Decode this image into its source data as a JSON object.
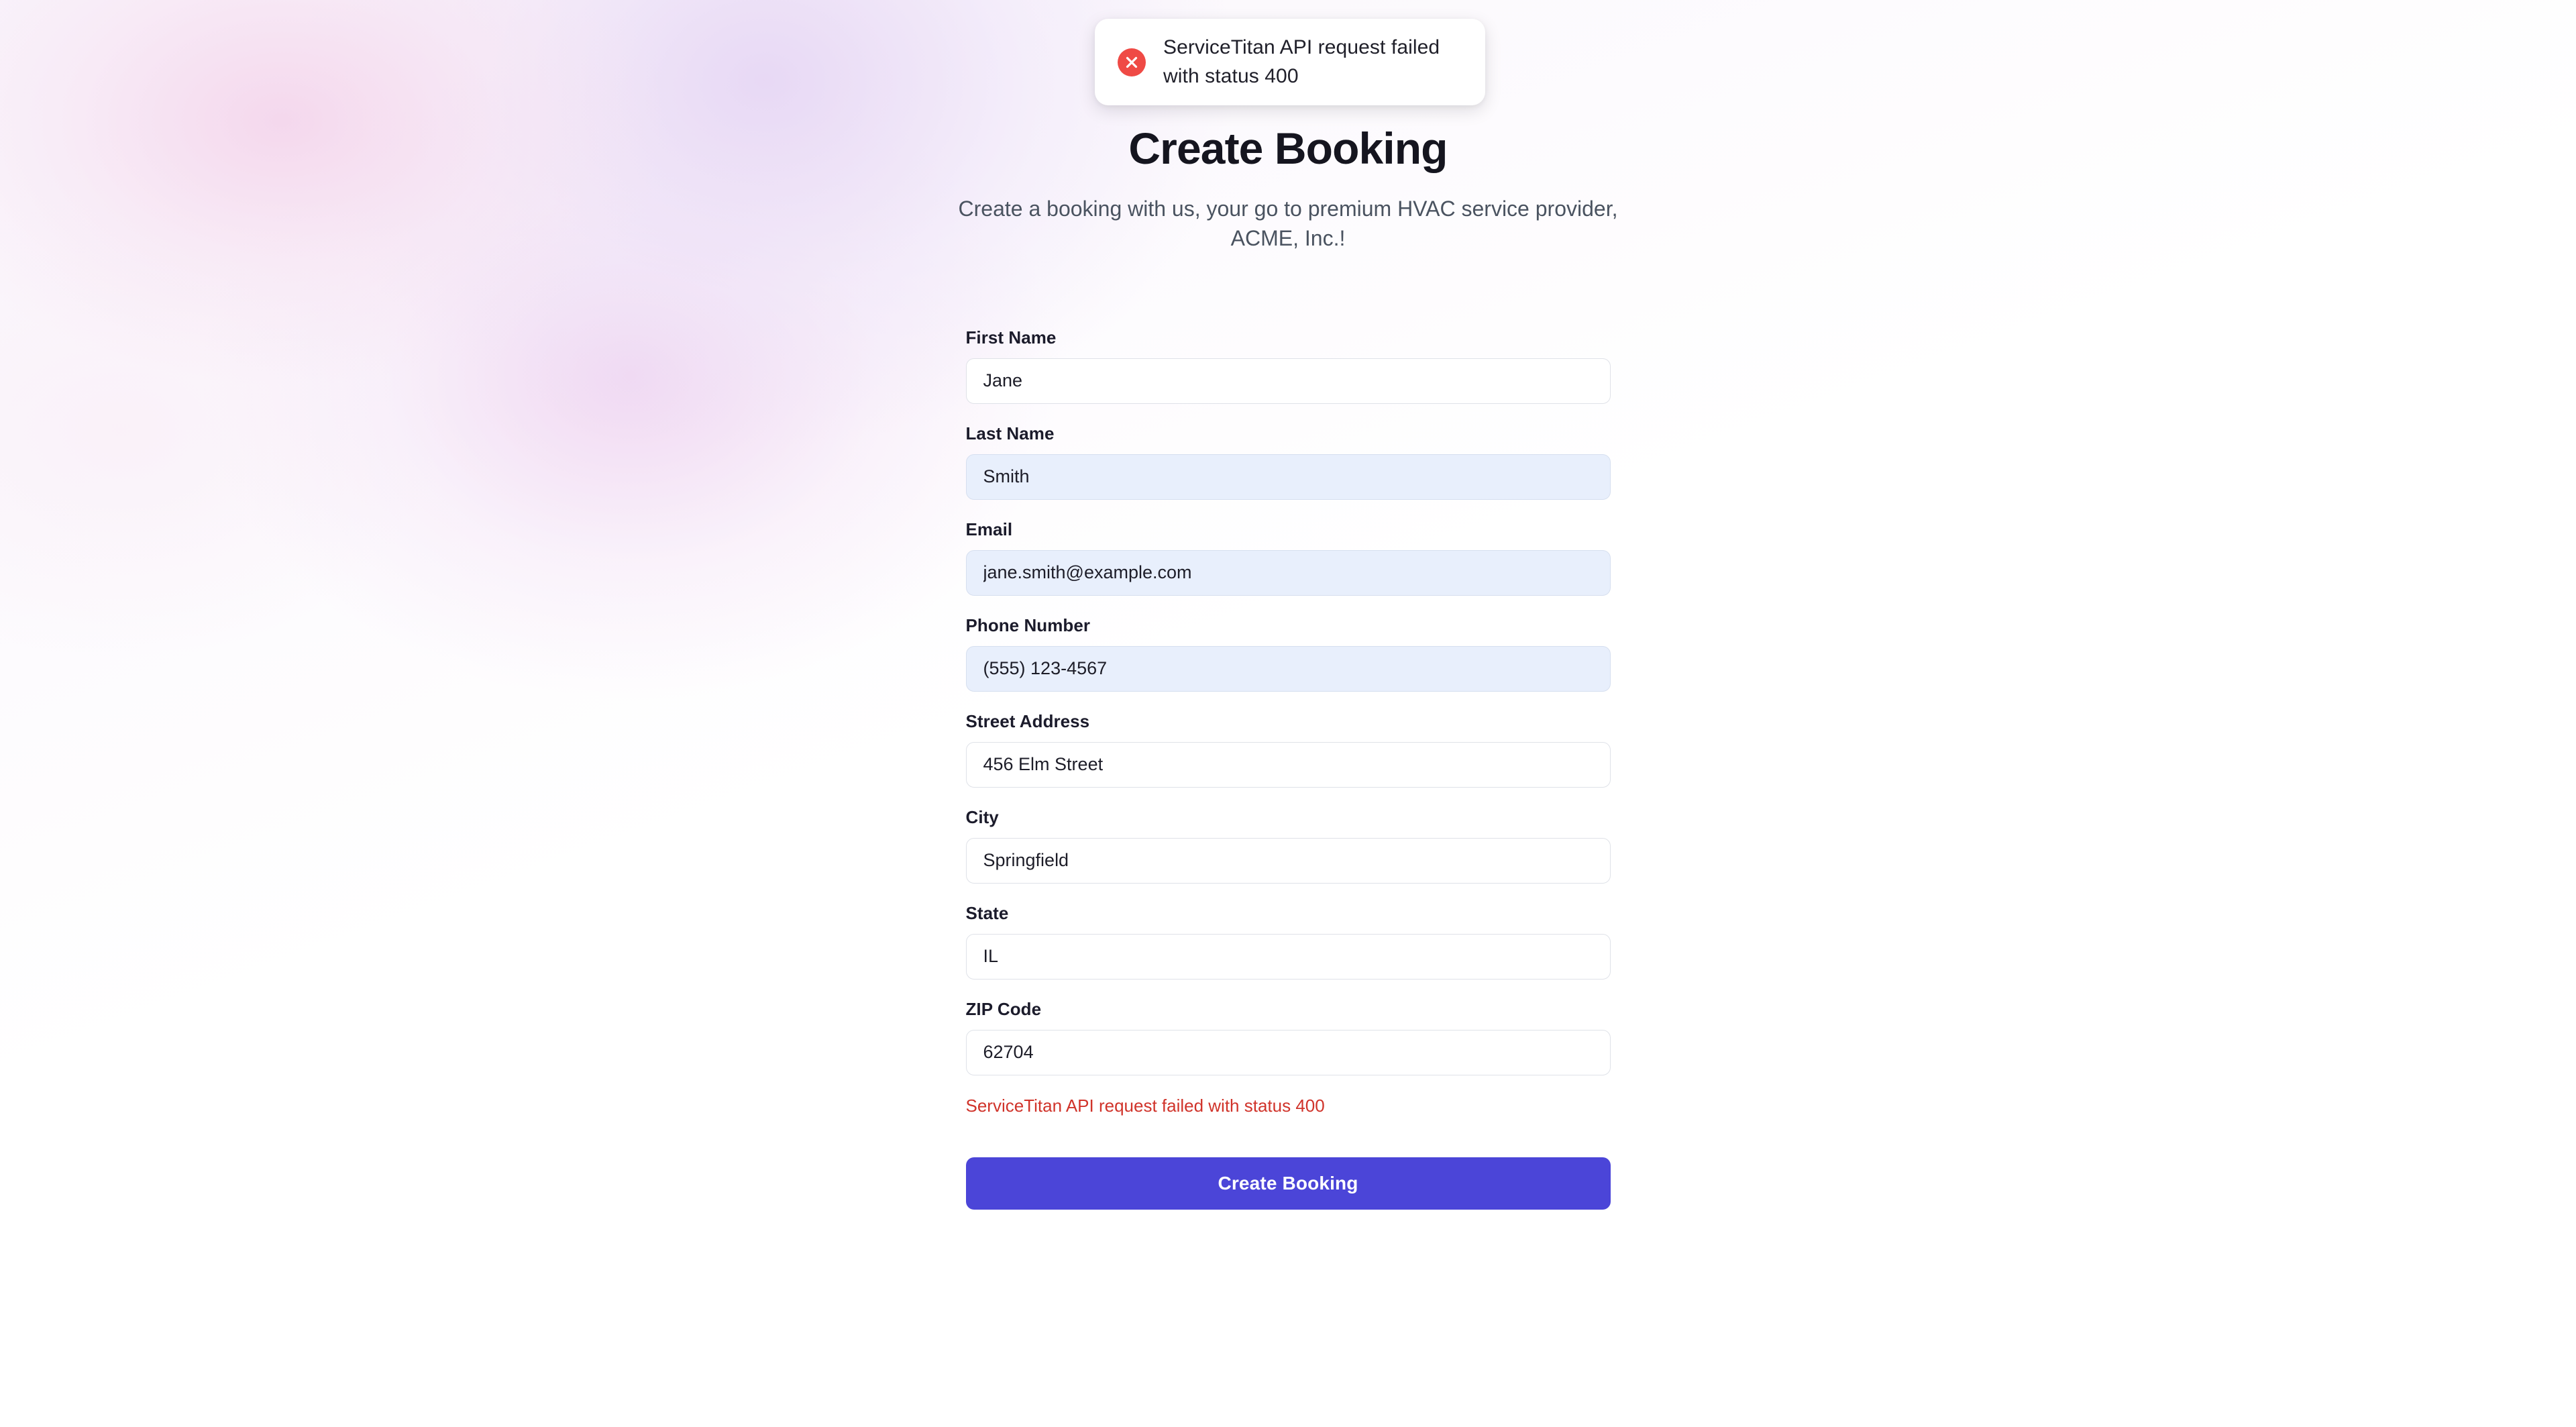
{
  "toast": {
    "icon": "error-circle-x-icon",
    "message": "ServiceTitan API request failed with status 400"
  },
  "header": {
    "title": "Create Booking",
    "subtitle": "Create a booking with us, your go to premium HVAC service provider, ACME, Inc.!"
  },
  "form": {
    "fields": [
      {
        "label": "First Name",
        "value": "Jane",
        "autofilled": false
      },
      {
        "label": "Last Name",
        "value": "Smith",
        "autofilled": true
      },
      {
        "label": "Email",
        "value": "jane.smith@example.com",
        "autofilled": true
      },
      {
        "label": "Phone Number",
        "value": "(555) 123-4567",
        "autofilled": true
      },
      {
        "label": "Street Address",
        "value": "456 Elm Street",
        "autofilled": false
      },
      {
        "label": "City",
        "value": "Springfield",
        "autofilled": false
      },
      {
        "label": "State",
        "value": "IL",
        "autofilled": false
      },
      {
        "label": "ZIP Code",
        "value": "62704",
        "autofilled": false
      }
    ],
    "error": "ServiceTitan API request failed with status 400",
    "submit_label": "Create Booking"
  },
  "colors": {
    "accent": "#4b45d8",
    "error": "#d0332a",
    "toast_icon": "#ef4a45",
    "autofill_background": "#e8effc",
    "title": "#15151f",
    "subtitle": "#4a5360"
  }
}
